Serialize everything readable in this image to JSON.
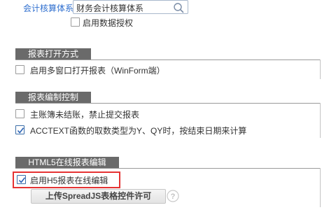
{
  "accounting": {
    "label": "会计核算体系",
    "value": "财务会计核算体系",
    "enable_data_auth": "启用数据授权"
  },
  "report_open": {
    "title": "报表打开方式",
    "multi_window": "启用多窗口打开报表（WinForm端）"
  },
  "report_edit": {
    "title": "报表编制控制",
    "no_close_forbid": "主账簿未结账，禁止提交报表",
    "acctext_label": "ACCTEXT函数的取数类型为Y、QY时，按结束日期来计算"
  },
  "html5": {
    "title": "HTML5在线报表编辑",
    "enable_h5": "启用H5报表在线编辑",
    "upload_button": "上传SpreadJS表格控件许可"
  },
  "icons": {
    "search": "search-icon",
    "help": "help-icon",
    "check": "check-icon"
  },
  "colors": {
    "label_blue": "#2f6fcf",
    "section_tab": "#6a6a6a",
    "highlight_red": "#e53333"
  }
}
